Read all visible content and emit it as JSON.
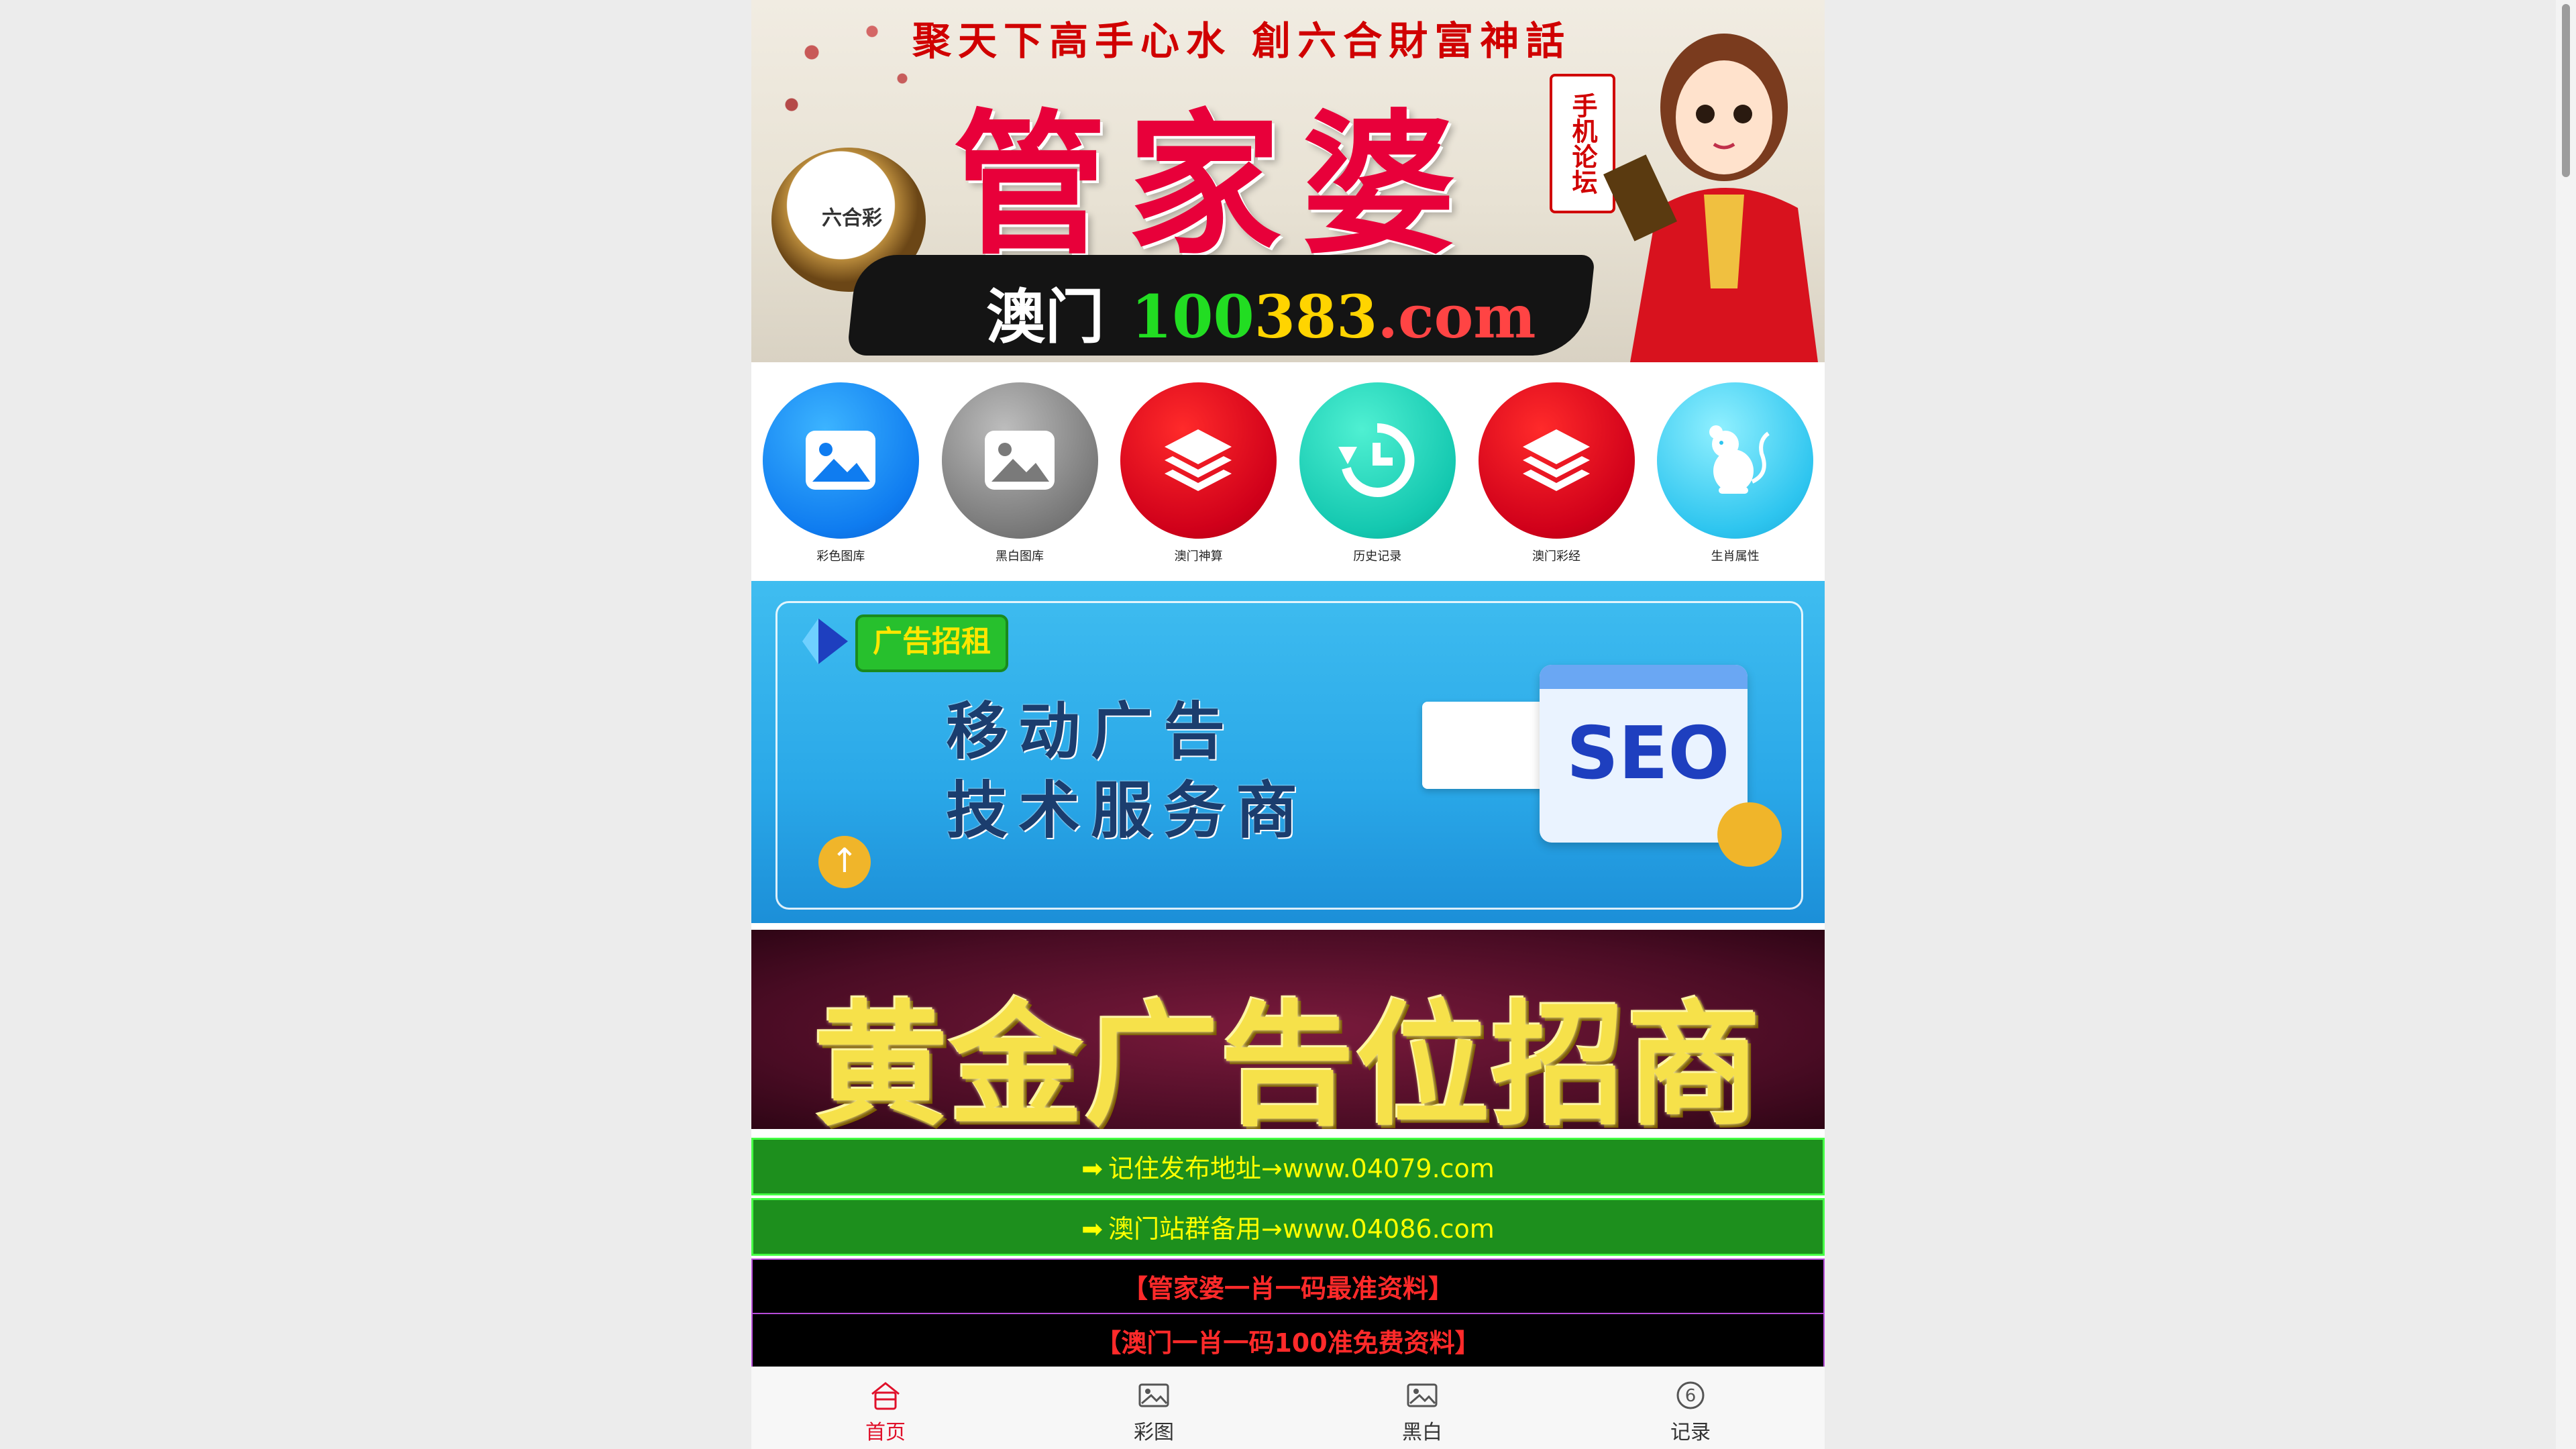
{
  "banner": {
    "slogan": "聚天下高手心水  創六合財富神話",
    "title": "管家婆",
    "mobile_tag": "手机论坛",
    "logo_text": "六合彩",
    "url_city": "澳门",
    "url_num1": "100",
    "url_num2": "383",
    "url_domain": ".com"
  },
  "icon_menu": {
    "items": [
      {
        "label": "彩色图库",
        "icon": "image-icon",
        "color": "#0f7cf0"
      },
      {
        "label": "黑白图库",
        "icon": "image-icon",
        "color": "#7a7a7a"
      },
      {
        "label": "澳门神算",
        "icon": "layers-icon",
        "color": "#d0001a"
      },
      {
        "label": "历史记录",
        "icon": "history-icon",
        "color": "#14c8b0"
      },
      {
        "label": "澳门彩经",
        "icon": "layers-icon",
        "color": "#d0001a"
      },
      {
        "label": "生肖属性",
        "icon": "rat-icon",
        "color": "#2ec5ef"
      }
    ]
  },
  "ad_banner_1": {
    "badge": "广告招租",
    "line1": "移动广告",
    "line2": "技术服务商",
    "seo": "SEO"
  },
  "ad_banner_2": {
    "text": "黄金广告位招商"
  },
  "links": [
    {
      "text": "记住发布地址→www.04079.com"
    },
    {
      "text": "澳门站群备用→www.04086.com"
    },
    {
      "text": "【管家婆一肖一码最准资料】"
    },
    {
      "text": "【澳门一肖一码100准免费资料】"
    }
  ],
  "bottom_nav": {
    "items": [
      {
        "label": "首页",
        "icon": "home-icon",
        "active": true
      },
      {
        "label": "彩图",
        "icon": "image-icon",
        "active": false
      },
      {
        "label": "黑白",
        "icon": "image-icon",
        "active": false
      },
      {
        "label": "记录",
        "icon": "record-6-icon",
        "active": false
      }
    ]
  },
  "colors": {
    "accent_red": "#e0102a",
    "link_green": "#1d8f1d",
    "link_yellow": "#ffff00"
  }
}
